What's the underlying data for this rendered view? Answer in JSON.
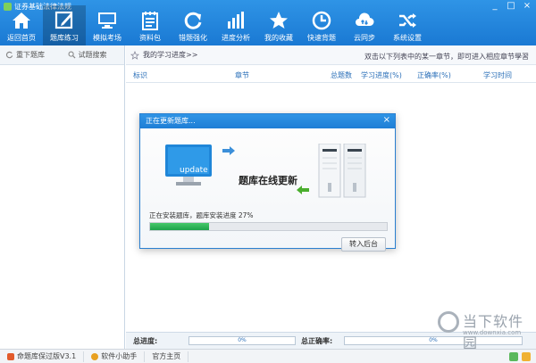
{
  "window": {
    "title": "证券基础法律法规",
    "controls": [
      "_",
      "□",
      "×"
    ]
  },
  "toolbar": {
    "items": [
      {
        "label": "返回首页",
        "icon": "home-icon"
      },
      {
        "label": "题库练习",
        "icon": "edit-icon",
        "active": true
      },
      {
        "label": "模拟考场",
        "icon": "monitor-icon"
      },
      {
        "label": "资料包",
        "icon": "calendar-icon"
      },
      {
        "label": "错题强化",
        "icon": "refresh-icon"
      },
      {
        "label": "进度分析",
        "icon": "bar-chart-icon"
      },
      {
        "label": "我的收藏",
        "icon": "star-icon"
      },
      {
        "label": "快速背题",
        "icon": "clock-icon"
      },
      {
        "label": "云同步",
        "icon": "cloud-sync-icon"
      },
      {
        "label": "系统设置",
        "icon": "shuffle-icon"
      }
    ]
  },
  "sidebar": {
    "tabs": [
      {
        "label": "重下题库",
        "icon": "refresh-icon"
      },
      {
        "label": "试题搜索",
        "icon": "search-icon"
      }
    ]
  },
  "main": {
    "crumb": "我的学习进度>>",
    "hint": "双击以下列表中的某一章节，即可进入相应章节學習",
    "columns": [
      "标识",
      "章节",
      "总题数",
      "学习进度(%)",
      "正确率(%)",
      "学习时间"
    ]
  },
  "stats": {
    "progress_label": "总进度:",
    "progress_value": "0%",
    "accuracy_label": "总正确率:",
    "accuracy_value": "0%"
  },
  "dialog": {
    "title": "正在更新题库...",
    "close": "×",
    "monitor_text": "update",
    "heading": "题库在线更新",
    "status": "正在安装题库，题库安装进度  27%",
    "progress": 0.25,
    "button": "转入后台"
  },
  "statusbar": {
    "items": [
      {
        "label": "命题库保过版V3.1"
      },
      {
        "label": "软件小助手"
      },
      {
        "label": "官方主页"
      }
    ]
  },
  "watermark": {
    "title": "当下软件园",
    "url": "www.downxia.com"
  },
  "colors": {
    "toolbar": "#1a79d3",
    "progress": "#1da34a",
    "accent": "#2a6fb8"
  }
}
